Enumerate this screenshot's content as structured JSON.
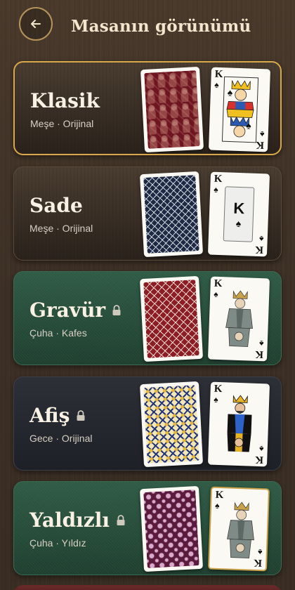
{
  "header": {
    "title": "Masanın görünümü",
    "back_icon": "arrow-left-icon"
  },
  "themes": [
    {
      "name": "Klasik",
      "subtitle": "Meşe · Orijinal",
      "locked": false,
      "selected": true
    },
    {
      "name": "Sade",
      "subtitle": "Meşe · Orijinal",
      "locked": false,
      "selected": false
    },
    {
      "name": "Gravür",
      "subtitle": "Çuha · Kafes",
      "locked": true,
      "selected": false
    },
    {
      "name": "Afiş",
      "subtitle": "Gece · Orijinal",
      "locked": true,
      "selected": false
    },
    {
      "name": "Yaldızlı",
      "subtitle": "Çuha · Yıldız",
      "locked": true,
      "selected": false
    }
  ],
  "card_rank": "K",
  "card_suit": "♠",
  "colors": {
    "accent": "#d9a84a",
    "title": "#f3e6cc"
  }
}
